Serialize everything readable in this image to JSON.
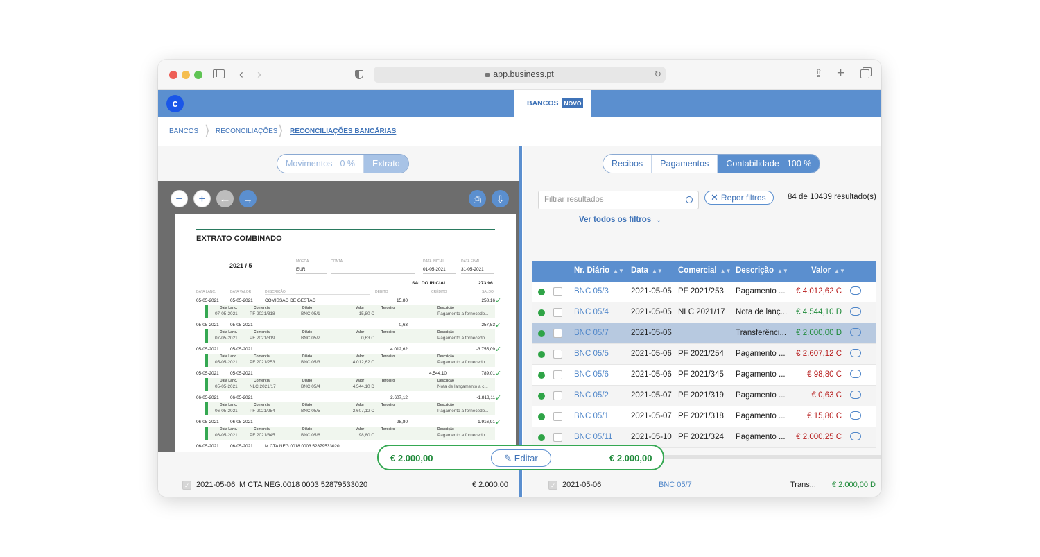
{
  "browser": {
    "url": "app.business.pt"
  },
  "app": {
    "logo_letter": "c",
    "tab_label": "BANCOS",
    "tab_badge": "NOVO"
  },
  "breadcrumb": [
    "BANCOS",
    "RECONCILIAÇÕES",
    "RECONCILIAÇÕES BANCÁRIAS"
  ],
  "left": {
    "segments": [
      "Movimentos - 0 %",
      "Extrato"
    ],
    "doc": {
      "title": "EXTRATO COMBINADO",
      "period": "2021 / 5",
      "moeda_label": "MOEDA",
      "moeda": "EUR",
      "conta_label": "CONTA",
      "data_inicial_label": "DATA INICIAL",
      "data_inicial": "01-05-2021",
      "data_final_label": "DATA FINAL",
      "data_final": "31-05-2021",
      "saldo_inicial_label": "SALDO INICIAL",
      "saldo_inicial": "273,96",
      "col_headers": [
        "DATA LANC.",
        "DATA VALOR",
        "DESCRIÇÃO",
        "DÉBITO",
        "CRÉDITO",
        "SALDO"
      ],
      "sub_headers": [
        "Data Lanc.",
        "Comercial",
        "Diário",
        "Valor",
        "Terceiro",
        "Descrição"
      ],
      "rows": [
        {
          "lanc": "05-05-2021",
          "valor": "05-05-2021",
          "desc": "COMISSÃO DE GESTÃO",
          "debito": "15,80",
          "credito": "",
          "saldo": "258,16",
          "s_lanc": "07-05-2021",
          "s_com": "PF 2021/318",
          "s_diario": "BNC 05/1",
          "s_valor": "15,80 C",
          "s_desc": "Pagamento a fornecedo..."
        },
        {
          "lanc": "05-05-2021",
          "valor": "05-05-2021",
          "desc": "",
          "debito": "0,63",
          "credito": "",
          "saldo": "257,53",
          "s_lanc": "07-05-2021",
          "s_com": "PF 2021/319",
          "s_diario": "BNC 05/2",
          "s_valor": "0,63 C",
          "s_desc": "Pagamento a fornecedo..."
        },
        {
          "lanc": "05-05-2021",
          "valor": "05-05-2021",
          "desc": "",
          "debito": "4.012,62",
          "credito": "",
          "saldo": "-3.755,09",
          "s_lanc": "05-05-2021",
          "s_com": "PF 2021/253",
          "s_diario": "BNC 05/3",
          "s_valor": "4.012,62 C",
          "s_desc": "Pagamento a fornecedo..."
        },
        {
          "lanc": "05-05-2021",
          "valor": "05-05-2021",
          "desc": "",
          "debito": "",
          "credito": "4.544,10",
          "saldo": "789,01",
          "s_lanc": "05-05-2021",
          "s_com": "NLC 2021/17",
          "s_diario": "BNC 05/4",
          "s_valor": "4.544,10 D",
          "s_desc": "Nota de lançamento a c..."
        },
        {
          "lanc": "06-05-2021",
          "valor": "06-05-2021",
          "desc": "",
          "debito": "2.607,12",
          "credito": "",
          "saldo": "-1.818,11",
          "s_lanc": "06-05-2021",
          "s_com": "PF 2021/254",
          "s_diario": "BNC 05/5",
          "s_valor": "2.607,12 C",
          "s_desc": "Pagamento a fornecedo..."
        },
        {
          "lanc": "06-05-2021",
          "valor": "06-05-2021",
          "desc": "",
          "debito": "98,80",
          "credito": "",
          "saldo": "-1.916,91",
          "s_lanc": "06-05-2021",
          "s_com": "PF 2021/345",
          "s_diario": "BNC 05/6",
          "s_valor": "98,80 C",
          "s_desc": "Pagamento a fornecedo..."
        }
      ],
      "last_row": {
        "lanc": "06-05-2021",
        "valor": "06-05-2021",
        "desc": "M CTA NEG.0018 0003 52879533020"
      }
    },
    "bottom": {
      "date": "2021-05-06",
      "desc": "M CTA NEG.0018 0003 52879533020",
      "amount": "€ 2.000,00"
    }
  },
  "match_bar": {
    "left_amount": "€ 2.000,00",
    "edit_label": "Editar",
    "right_amount": "€ 2.000,00"
  },
  "right": {
    "segments": [
      "Recibos",
      "Pagamentos",
      "Contabilidade - 100 %"
    ],
    "filter_placeholder": "Filtrar resultados",
    "reset_label": "Repor filtros",
    "result_count": "84 de 10439 resultado(s)",
    "see_all_filters": "Ver todos os filtros",
    "columns": [
      "Nr. Diário",
      "Data",
      "Comercial",
      "Descrição",
      "Valor"
    ],
    "rows": [
      {
        "diario": "BNC 05/3",
        "data": "2021-05-05",
        "comercial": "PF 2021/253",
        "descricao": "Pagamento ...",
        "valor": "€ 4.012,62 C",
        "type": "C"
      },
      {
        "diario": "BNC 05/4",
        "data": "2021-05-05",
        "comercial": "NLC 2021/17",
        "descricao": "Nota de lanç...",
        "valor": "€ 4.544,10 D",
        "type": "D"
      },
      {
        "diario": "BNC 05/7",
        "data": "2021-05-06",
        "comercial": "",
        "descricao": "Transferênci...",
        "valor": "€ 2.000,00 D",
        "type": "D"
      },
      {
        "diario": "BNC 05/5",
        "data": "2021-05-06",
        "comercial": "PF 2021/254",
        "descricao": "Pagamento ...",
        "valor": "€ 2.607,12 C",
        "type": "C"
      },
      {
        "diario": "BNC 05/6",
        "data": "2021-05-06",
        "comercial": "PF 2021/345",
        "descricao": "Pagamento ...",
        "valor": "€ 98,80 C",
        "type": "C"
      },
      {
        "diario": "BNC 05/2",
        "data": "2021-05-07",
        "comercial": "PF 2021/319",
        "descricao": "Pagamento ...",
        "valor": "€ 0,63 C",
        "type": "C"
      },
      {
        "diario": "BNC 05/1",
        "data": "2021-05-07",
        "comercial": "PF 2021/318",
        "descricao": "Pagamento ...",
        "valor": "€ 15,80 C",
        "type": "C"
      },
      {
        "diario": "BNC 05/11",
        "data": "2021-05-10",
        "comercial": "PF 2021/324",
        "descricao": "Pagamento ...",
        "valor": "€ 2.000,25 C",
        "type": "C"
      }
    ],
    "bottom": {
      "date": "2021-05-06",
      "diario": "BNC 05/7",
      "descricao": "Trans...",
      "amount": "€ 2.000,00 D"
    }
  },
  "colors": {
    "accent": "#5b8fcf",
    "credit": "#b71c1c",
    "debit": "#1f8a3a",
    "match": "#35a852"
  }
}
